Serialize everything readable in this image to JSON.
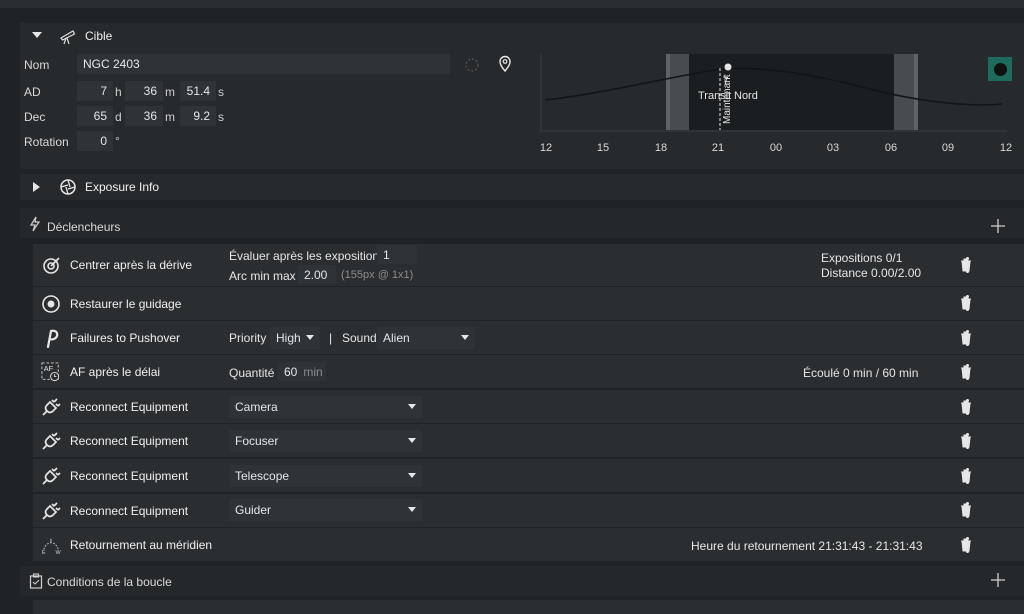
{
  "target": {
    "section_title": "Cible",
    "name_label": "Nom",
    "name_value": "NGC 2403",
    "ra_label": "AD",
    "ra_h": "7",
    "ra_h_unit": "h",
    "ra_m": "36",
    "ra_m_unit": "m",
    "ra_s": "51.4",
    "ra_s_unit": "s",
    "dec_label": "Dec",
    "dec_d": "65",
    "dec_d_unit": "d",
    "dec_m": "36",
    "dec_m_unit": "m",
    "dec_s": "9.2",
    "dec_s_unit": "s",
    "rotation_label": "Rotation",
    "rotation_value": "0",
    "rotation_unit": "°"
  },
  "altitude_chart": {
    "transit_label": "Transit",
    "north_label": "Nord",
    "meridian_label": "Maintenant",
    "ticks": [
      "12",
      "15",
      "18",
      "21",
      "00",
      "03",
      "06",
      "09",
      "12"
    ]
  },
  "exposure": {
    "section_title": "Exposure Info"
  },
  "triggers": {
    "section_title": "Déclencheurs",
    "items": [
      {
        "name": "Centrer après la dérive",
        "param1_label": "Évaluer après les expositions",
        "param1_value": "1",
        "param2_label": "Arc min max",
        "param2_value": "2.00",
        "param2_hint": "(155px @ 1x1)",
        "status1": "Expositions 0/1",
        "status2": "Distance 0.00/2.00"
      },
      {
        "name": "Restaurer le guidage"
      },
      {
        "name": "Failures to Pushover",
        "priority_label": "Priority",
        "priority_value": "High",
        "separator": "|",
        "sound_label": "Sound",
        "sound_value": "Alien"
      },
      {
        "name": "AF après le délai",
        "qty_label": "Quantité",
        "qty_value": "60",
        "qty_unit": "min",
        "status": "Écoulé 0 min / 60 min"
      },
      {
        "name": "Reconnect Equipment",
        "device": "Camera"
      },
      {
        "name": "Reconnect Equipment",
        "device": "Focuser"
      },
      {
        "name": "Reconnect Equipment",
        "device": "Telescope"
      },
      {
        "name": "Reconnect Equipment",
        "device": "Guider"
      },
      {
        "name": "Retournement au méridien",
        "status": "Heure du retournement 21:31:43  -  21:31:43"
      }
    ]
  },
  "loop": {
    "section_title": "Conditions de la boucle"
  }
}
